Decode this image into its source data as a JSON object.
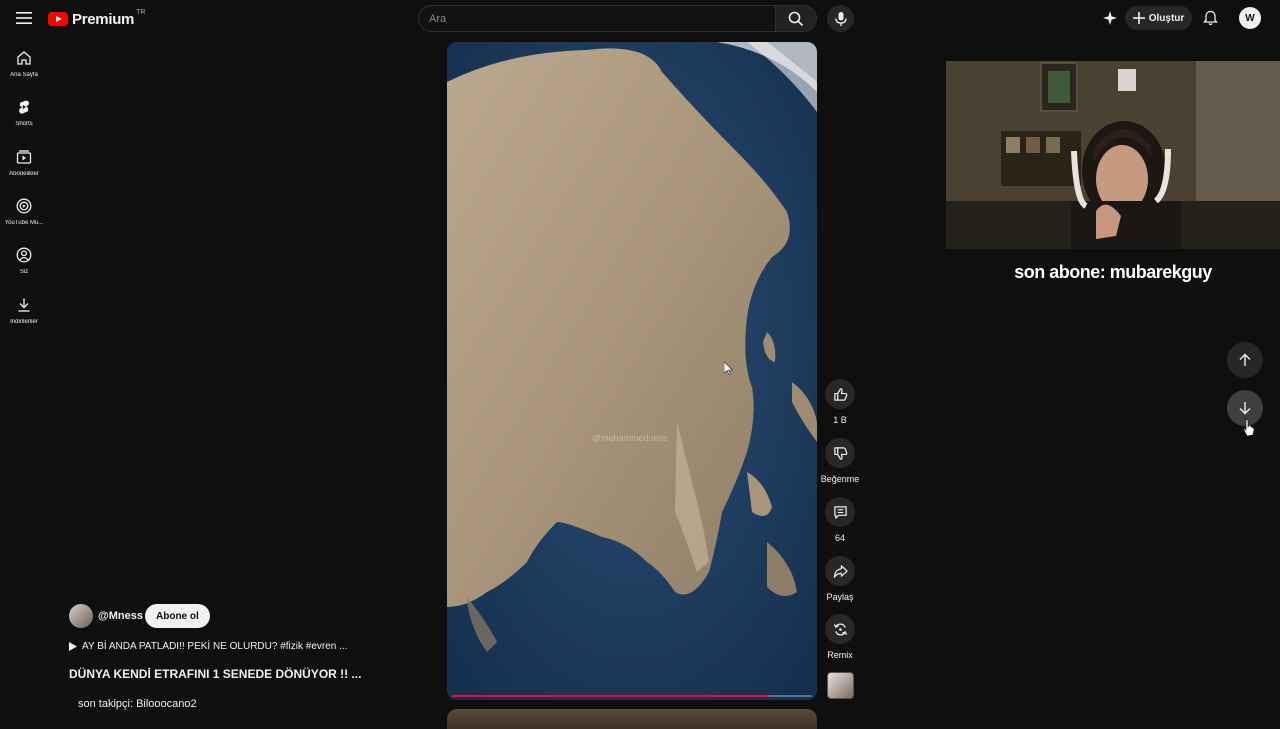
{
  "header": {
    "logo_text": "Premium",
    "logo_country": "TR",
    "search_placeholder": "Ara",
    "create_label": "Oluştur",
    "account_initial": "W"
  },
  "sidebar": {
    "items": [
      {
        "label": "Ana Sayfa",
        "icon": "home-icon"
      },
      {
        "label": "Shorts",
        "icon": "shorts-icon"
      },
      {
        "label": "Abonelikler",
        "icon": "subscriptions-icon"
      },
      {
        "label": "YouTube Mu...",
        "icon": "youtube-music-icon"
      },
      {
        "label": "Siz",
        "icon": "you-icon"
      },
      {
        "label": "İndirilenler",
        "icon": "downloads-icon"
      }
    ]
  },
  "short": {
    "watermark": "@muhammedness",
    "progress": 0.88,
    "channel_name": "@Mness",
    "subscribe_label": "Abone ol",
    "related_video": "AY Bİ ANDA PATLADI!! PEKİ NE OLURDU? #fizik #evren ...",
    "title": "DÜNYA KENDİ ETRAFINI 1 SENEDE DÖNÜYOR !! ...",
    "follower_overlay": "son takipçi: Bilooocano2"
  },
  "actions": {
    "like_count": "1 B",
    "dislike_label": "Beğenme",
    "comment_count": "64",
    "share_label": "Paylaş",
    "remix_label": "Remix"
  },
  "stream_overlay": {
    "last_subscriber": "son abone: mubarekguy"
  },
  "colors": {
    "background": "#0f0f0f",
    "brand_red": "#ff0000",
    "progress_red": "#ff0033",
    "surface": "#272727"
  }
}
